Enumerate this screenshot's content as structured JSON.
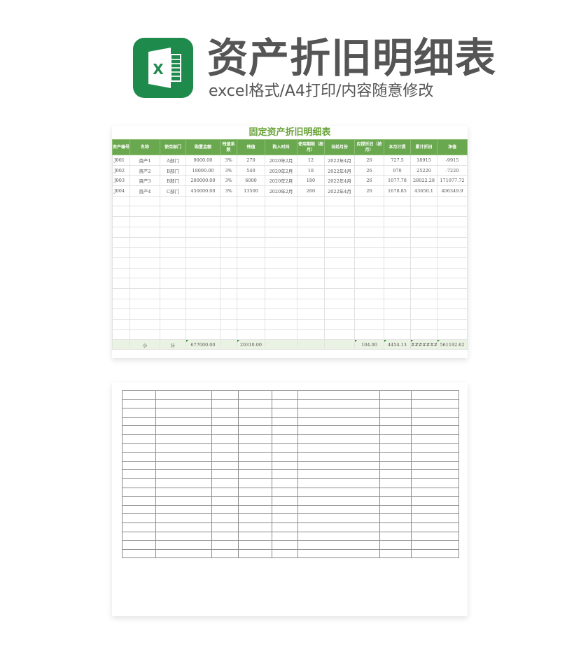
{
  "header": {
    "logo_icon": "excel-icon",
    "logo_letter": "X",
    "title": "资产折旧明细表",
    "subtitle": "excel格式/A4打印/内容随意修改",
    "brand_color": "#1e8a4c"
  },
  "sheet": {
    "title": "固定资产折旧明细表",
    "accent_color": "#6aa84f",
    "columns": [
      "资产编号",
      "名称",
      "使用部门",
      "购置金额",
      "残值系数",
      "残值",
      "购入时间",
      "使用期限（按月）",
      "当前月份",
      "应提折旧（按月）",
      "本月计提",
      "累计折旧",
      "净值"
    ],
    "rows": [
      [
        "J001",
        "资产1",
        "A部门",
        "9000.00",
        "3%",
        "270",
        "2020年2月",
        "12",
        "2022年4月",
        "26",
        "727.5",
        "18915",
        "-9915"
      ],
      [
        "J002",
        "资产2",
        "B部门",
        "18000.00",
        "3%",
        "540",
        "2020年2月",
        "18",
        "2022年4月",
        "26",
        "970",
        "25220",
        "-7220"
      ],
      [
        "J003",
        "资产3",
        "B部门",
        "200000.00",
        "3%",
        "6000",
        "2020年2月",
        "180",
        "2022年4月",
        "26",
        "1077.78",
        "28022.28",
        "171977.72"
      ],
      [
        "J004",
        "资产4",
        "C部门",
        "450000.00",
        "3%",
        "13500",
        "2020年2月",
        "260",
        "2022年4月",
        "26",
        "1678.85",
        "43650.1",
        "406349.9"
      ]
    ],
    "empty_row_count": 14,
    "total": {
      "label_a": "小",
      "label_b": "计",
      "purchase_amount": "677000.00",
      "salvage": "20310.00",
      "depreciation_months": "104.00",
      "monthly": "4454.13",
      "accumulated": "#########",
      "net_value": "561192.62"
    }
  },
  "blank_sheet": {
    "row_count": 19,
    "col_count": 8
  }
}
